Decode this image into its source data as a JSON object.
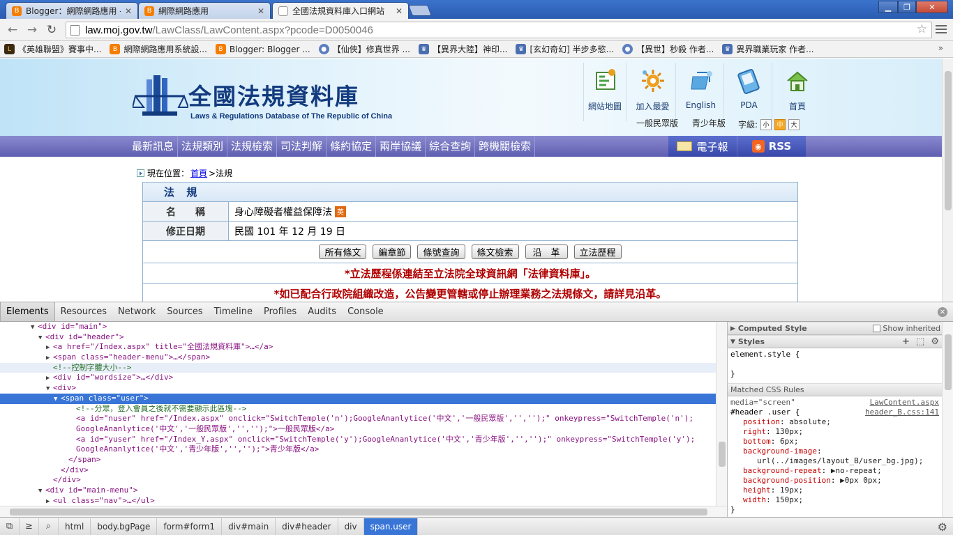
{
  "browser": {
    "tabs": [
      {
        "title": "Blogger：網際網路應用 -",
        "icon": "blogger-icon"
      },
      {
        "title": "網際網路應用",
        "icon": "blogger-icon"
      },
      {
        "title": "全國法規資料庫入口網站",
        "icon": "page-icon"
      }
    ],
    "url_host": "law.moj.gov.tw",
    "url_path": "/LawClass/LawContent.aspx?pcode=D0050046",
    "bookmarks": [
      {
        "label": "《英雄聯盟》賽事中...",
        "color": "#d4a017"
      },
      {
        "label": "網際網路應用系統設...",
        "color": "#f57d00"
      },
      {
        "label": "Blogger: Blogger ...",
        "color": "#f57d00"
      },
      {
        "label": "【仙俠】修真世界 ...",
        "color": "#5b7fc0"
      },
      {
        "label": "【異界大陸】神印...",
        "color": "#4a6fb0"
      },
      {
        "label": "[玄幻奇幻] 半步多慾...",
        "color": "#4a6fb0"
      },
      {
        "label": "【異世】秒殺 作者...",
        "color": "#5b7fc0"
      },
      {
        "label": "異界職業玩家 作者...",
        "color": "#4a6fb0"
      }
    ],
    "bookmarks_more": "»"
  },
  "site": {
    "title": "全國法規資料庫",
    "subtitle": "Laws & Regulations Database of The Republic of China",
    "header_menu": [
      {
        "label": "網站地圖",
        "icon": "sitemap-icon"
      },
      {
        "label": "加入最愛",
        "icon": "favorite-icon"
      },
      {
        "label": "English",
        "icon": "english-icon"
      },
      {
        "label": "PDA",
        "icon": "pda-icon"
      },
      {
        "label": "首頁",
        "icon": "home-icon"
      }
    ],
    "user_links": [
      "一般民眾版",
      "青少年版"
    ],
    "wordsize_label": "字級:",
    "wordsize_options": [
      "小",
      "中",
      "大"
    ],
    "main_menu": [
      "最新訊息",
      "法規類別",
      "法規檢索",
      "司法判解",
      "條約協定",
      "兩岸協議",
      "綜合查詢",
      "跨機關檢索"
    ],
    "epaper": "電子報",
    "rss": "RSS",
    "breadcrumb_prefix": "現在位置：",
    "breadcrumb_home": "首頁",
    "breadcrumb_sep": " > ",
    "breadcrumb_current": "法規"
  },
  "law": {
    "section_title": "法 規",
    "name_label": "名　　稱",
    "name_value": "身心障礙者權益保障法",
    "en_badge": "英",
    "date_label": "修正日期",
    "date_value": "民國 101 年 12 月 19 日",
    "buttons": [
      "所有條文",
      "編章節",
      "條號查詢",
      "條文檢索",
      "沿　革",
      "立法歷程"
    ],
    "note1": "*立法歷程係連結至立法院全球資訊網「法律資料庫」。",
    "note2": "*如已配合行政院組織改造，公告變更管轄或停止辦理業務之法規條文，請詳見沿革。"
  },
  "devtools": {
    "tabs": [
      "Elements",
      "Resources",
      "Network",
      "Sources",
      "Timeline",
      "Profiles",
      "Audits",
      "Console"
    ],
    "dom_lines": [
      {
        "indent": 4,
        "tri": "▼",
        "html": "<div id=\"main\">"
      },
      {
        "indent": 5,
        "tri": "▼",
        "html": "<div id=\"header\">"
      },
      {
        "indent": 6,
        "tri": "▶",
        "html": "<a href=\"/Index.aspx\" title=\"全國法規資料庫\">…</a>"
      },
      {
        "indent": 6,
        "tri": "▶",
        "html": "<span class=\"header-menu\">…</span>"
      },
      {
        "indent": 6,
        "tri": "",
        "html": "<!--控制字體大小-->",
        "comment": true
      },
      {
        "indent": 6,
        "tri": "▶",
        "html": "<div id=\"wordsize\">…</div>"
      },
      {
        "indent": 6,
        "tri": "▼",
        "html": "<div>"
      },
      {
        "indent": 7,
        "tri": "▼",
        "html": "<span class=\"user\">",
        "selected": true
      },
      {
        "indent": 9,
        "tri": "",
        "html": "<!--分眾，登入會員之後就不需要顯示此區塊-->",
        "comment": true
      },
      {
        "indent": 9,
        "tri": "",
        "html": "<a id=\"nuser\" href=\"/Index.aspx\" onclick=\"SwitchTemple('n');GoogleAnanlytice('中文','一般民眾版','','');\" onkeypress=\"SwitchTemple('n');"
      },
      {
        "indent": 9,
        "tri": "",
        "html": "GoogleAnanlytice('中文','一般民眾版','','');\">一般民眾版</a>"
      },
      {
        "indent": 9,
        "tri": "",
        "html": "<a id=\"yuser\" href=\"/Index_Y.aspx\" onclick=\"SwitchTemple('y');GoogleAnanlytice('中文','青少年版','','');\" onkeypress=\"SwitchTemple('y');"
      },
      {
        "indent": 9,
        "tri": "",
        "html": "GoogleAnanlytice('中文','青少年版','','');\">青少年版</a>"
      },
      {
        "indent": 8,
        "tri": "",
        "html": "</span>"
      },
      {
        "indent": 7,
        "tri": "",
        "html": "</div>"
      },
      {
        "indent": 6,
        "tri": "",
        "html": "</div>"
      },
      {
        "indent": 5,
        "tri": "▼",
        "html": "<div id=\"main-menu\">"
      },
      {
        "indent": 6,
        "tri": "▶",
        "html": "<ul class=\"nav\">…</ul>"
      }
    ],
    "computed_style": "Computed Style",
    "show_inherited": "Show inherited",
    "styles": "Styles",
    "element_style": "element.style {",
    "close_brace": "}",
    "matched_rules": "Matched CSS Rules",
    "media": "media=\"screen\"",
    "src1": "LawContent.aspx",
    "selector": "#header .user {",
    "src2": "header_B.css:141",
    "props": [
      {
        "name": "position",
        "value": "absolute;"
      },
      {
        "name": "right",
        "value": "130px;"
      },
      {
        "name": "bottom",
        "value": "6px;"
      },
      {
        "name": "background-image",
        "value": ""
      },
      {
        "name": "",
        "value": "url(../images/layout_B/user_bg.jpg);"
      },
      {
        "name": "background-repeat",
        "value": "▶no-repeat;"
      },
      {
        "name": "background-position",
        "value": "▶0px 0px;"
      },
      {
        "name": "height",
        "value": "19px;"
      },
      {
        "name": "width",
        "value": "150px;"
      }
    ],
    "breadcrumbs": [
      "html",
      "body.bgPage",
      "form#form1",
      "div#main",
      "div#header",
      "div",
      "span.user"
    ]
  }
}
